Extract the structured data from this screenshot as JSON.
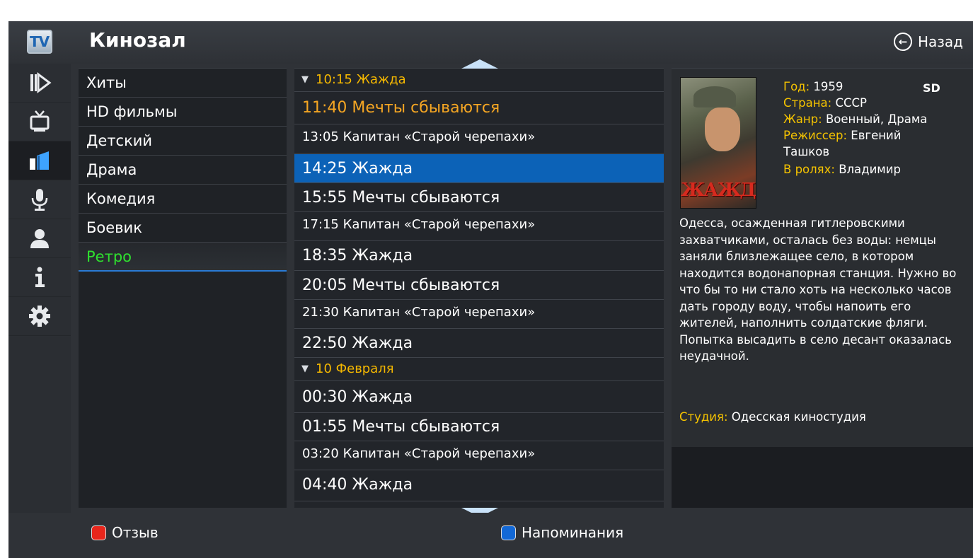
{
  "header": {
    "logo_text": "TV",
    "title": "Кинозал",
    "back_label": "Назад"
  },
  "rail": {
    "items": [
      {
        "icon": "play-icon",
        "active": false
      },
      {
        "icon": "tv-icon",
        "active": false
      },
      {
        "icon": "cinema-icon",
        "active": true
      },
      {
        "icon": "microphone-icon",
        "active": false
      },
      {
        "icon": "user-icon",
        "active": false
      },
      {
        "icon": "info-icon",
        "active": false
      },
      {
        "icon": "gear-icon",
        "active": false
      }
    ]
  },
  "categories": [
    {
      "label": "Хиты"
    },
    {
      "label": "HD фильмы"
    },
    {
      "label": "Детский"
    },
    {
      "label": "Драма"
    },
    {
      "label": "Комедия"
    },
    {
      "label": "Боевик"
    },
    {
      "label": "Ретро",
      "selected": true
    }
  ],
  "schedule": [
    {
      "type": "date",
      "text": "10:15 Жажда"
    },
    {
      "type": "large",
      "text": "11:40 Мечты сбываются",
      "current": true
    },
    {
      "type": "small",
      "text": "13:05 Капитан «Старой черепахи»"
    },
    {
      "type": "large",
      "text": "14:25 Жажда",
      "selected": true
    },
    {
      "type": "large",
      "text": "15:55 Мечты сбываются"
    },
    {
      "type": "small",
      "text": "17:15 Капитан «Старой черепахи»"
    },
    {
      "type": "large",
      "text": "18:35 Жажда"
    },
    {
      "type": "large",
      "text": "20:05 Мечты сбываются"
    },
    {
      "type": "small",
      "text": "21:30 Капитан «Старой черепахи»"
    },
    {
      "type": "large",
      "text": "22:50 Жажда"
    },
    {
      "type": "date",
      "text": "10 Февраля"
    },
    {
      "type": "large",
      "text": "00:30 Жажда"
    },
    {
      "type": "large",
      "text": "01:55 Мечты сбываются"
    },
    {
      "type": "small",
      "text": "03:20 Капитан «Старой черепахи»"
    },
    {
      "type": "large",
      "text": "04:40 Жажда"
    }
  ],
  "info": {
    "poster_title": "ЖАЖДА",
    "quality": "SD",
    "year_label": "Год:",
    "year": "1959",
    "country_label": "Страна:",
    "country": "СССР",
    "genre_label": "Жанр:",
    "genre": "Военный, Драма",
    "director_label": "Режиссер:",
    "director_1": "Евгений",
    "director_2": "Ташков",
    "cast_label": "В ролях:",
    "cast": "Владимир",
    "description": "Одесса, осажденная гитлеровскими захватчиками, осталась без воды: немцы заняли близлежащее село, в котором находится водонапорная станция. Нужно во что бы то ни стало хоть на несколько часов дать городу воду, чтобы напоить его жителей, наполнить солдатские фляги. Попытка высадить в село десант оказалась неудачной.",
    "studio_label": "Студия:",
    "studio": "Одесская киностудия"
  },
  "footer": {
    "red_label": "Отзыв",
    "blue_label": "Напоминания"
  },
  "colors": {
    "accent_blue": "#0c62b7",
    "selected_category": "#2fe12f",
    "current_program": "#f5a623",
    "meta_key": "#f5c300"
  }
}
